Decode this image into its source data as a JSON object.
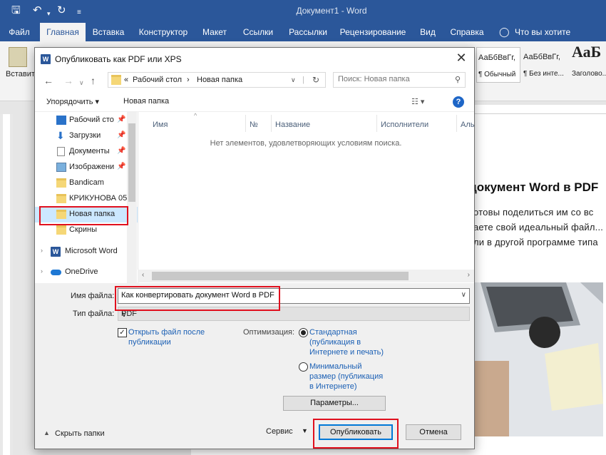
{
  "window": {
    "title": "Документ1  -  Word"
  },
  "quick_access": {
    "save_icon": "save-icon",
    "undo_icon": "undo-icon",
    "redo_icon": "redo-icon"
  },
  "ribbon": {
    "tabs": [
      "Файл",
      "Главная",
      "Вставка",
      "Конструктор",
      "Макет",
      "Ссылки",
      "Рассылки",
      "Рецензирование",
      "Вид",
      "Справка"
    ],
    "active_tab": "Главная",
    "tell_me": "Что вы хотите сделать?",
    "paste_label": "Вставить",
    "styles": [
      {
        "preview": "АаБбВвГг,",
        "name": "¶ Обычный"
      },
      {
        "preview": "АаБбВвГг,",
        "name": "¶ Без инте..."
      },
      {
        "preview": "АаБ",
        "name": "Заголово..."
      }
    ]
  },
  "document": {
    "heading": "документ Word в PDF",
    "lines": [
      "отовы поделиться им со вс",
      "аете свой идеальный файл... ",
      "ли в другой программе типа"
    ]
  },
  "dialog": {
    "title": "Опубликовать как PDF или XPS",
    "breadcrumb": [
      "«",
      "Рабочий стол",
      "›",
      "Новая папка",
      "›"
    ],
    "search_placeholder": "Поиск: Новая папка",
    "organize_label": "Упорядочить ▾",
    "new_folder_label": "Новая папка",
    "nav_items": [
      {
        "label": "Рабочий сто",
        "pinned": true
      },
      {
        "label": "Загрузки",
        "pinned": true
      },
      {
        "label": "Документы",
        "pinned": true
      },
      {
        "label": "Изображени",
        "pinned": true
      },
      {
        "label": "Bandicam",
        "pinned": false
      },
      {
        "label": "КРИКУНОВА 05",
        "pinned": false
      },
      {
        "label": "Новая папка",
        "pinned": false
      },
      {
        "label": "Скрины",
        "pinned": false
      },
      {
        "label": "Microsoft Word",
        "pinned": false
      },
      {
        "label": "OneDrive",
        "pinned": false
      }
    ],
    "columns": [
      "Имя",
      "№",
      "Название",
      "Исполнители",
      "Аль"
    ],
    "empty_message": "Нет элементов, удовлетворяющих условиям поиска.",
    "file_name_label": "Имя файла:",
    "file_name_value": "Как конвертировать документ Word в PDF",
    "file_type_label": "Тип файла:",
    "file_type_value": "PDF",
    "open_after_publish_line1": "Открыть файл после",
    "open_after_publish_line2": "публикации",
    "open_after_publish_checked": true,
    "optimization_label": "Оптимизация:",
    "opt_standard": [
      "Стандартная",
      "(публикация в",
      "Интернете и печать)"
    ],
    "opt_minimal": [
      "Минимальный",
      "размер (публикация",
      "в Интернете)"
    ],
    "options_button": "Параметры...",
    "hide_folders": "Скрыть папки",
    "service_label": "Сервис",
    "publish_button": "Опубликовать",
    "cancel_button": "Отмена"
  }
}
